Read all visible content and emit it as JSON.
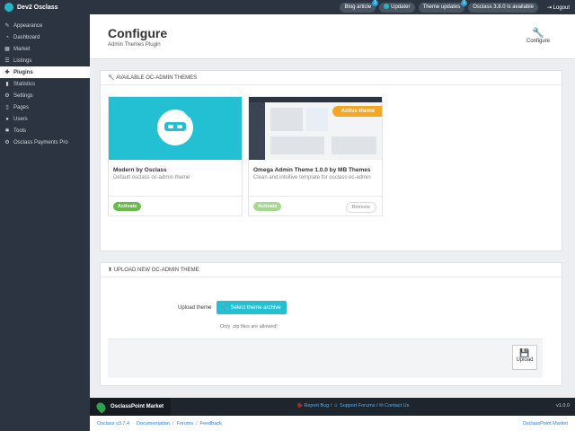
{
  "topbar": {
    "brand": "Dev2 Osclass",
    "blog": "Blog article",
    "blog_badge": "1",
    "updater": "Updater",
    "theme_updates": "Theme updates",
    "theme_badge": "1",
    "version_notice": "Osclass 3.8.0 is available",
    "logout": "Logout"
  },
  "sidebar": {
    "items": [
      {
        "label": "Appearance",
        "icon": "brush-icon"
      },
      {
        "label": "Dashboard",
        "icon": "dashboard-icon"
      },
      {
        "label": "Market",
        "icon": "market-icon"
      },
      {
        "label": "Listings",
        "icon": "listings-icon"
      },
      {
        "label": "Plugins",
        "icon": "puzzle-icon",
        "active": true
      },
      {
        "label": "Statistics",
        "icon": "stats-icon"
      },
      {
        "label": "Settings",
        "icon": "gear-icon"
      },
      {
        "label": "Pages",
        "icon": "page-icon"
      },
      {
        "label": "Users",
        "icon": "user-icon"
      },
      {
        "label": "Tools",
        "icon": "wrench-icon"
      },
      {
        "label": "Osclass Payments Pro",
        "icon": "gear-icon"
      }
    ]
  },
  "header": {
    "title": "Configure",
    "subtitle": "Admin Themes Plugin",
    "config_label": "Configure"
  },
  "themes_panel": {
    "title": "AVAILABLE OC-ADMIN THEMES",
    "cards": [
      {
        "name": "Modern by Osclass",
        "desc": "Default osclass oc-admin theme",
        "activate": "Activate"
      },
      {
        "name": "Omega Admin Theme 1.0.0 by MB Themes",
        "desc": "Clean and intuitive template for osclass oc-admin",
        "activate": "Activate",
        "remove": "Remove",
        "ribbon": "Active theme"
      }
    ]
  },
  "upload_panel": {
    "title": "UPLOAD NEW OC-ADMIN THEME",
    "label": "Upload theme",
    "button": "Select theme archive",
    "hint": "Only .zip files are allowed!",
    "upload": "Upload"
  },
  "footer": {
    "market": "OsclassPoint Market",
    "report": "Report Bug",
    "support": "Support Forums",
    "contact": "Contact Us",
    "version": "v1.0.0"
  },
  "bottom": {
    "osclass": "Osclass v3.7.4",
    "documentation": "Documentation",
    "forums": "Forums",
    "feedback": "Feedback",
    "right": "OsclassPoint Market"
  },
  "colors": {
    "accent": "#23bfd3",
    "sidebar": "#2b3440",
    "activate": "#66bb49",
    "ribbon": "#f5a623"
  }
}
